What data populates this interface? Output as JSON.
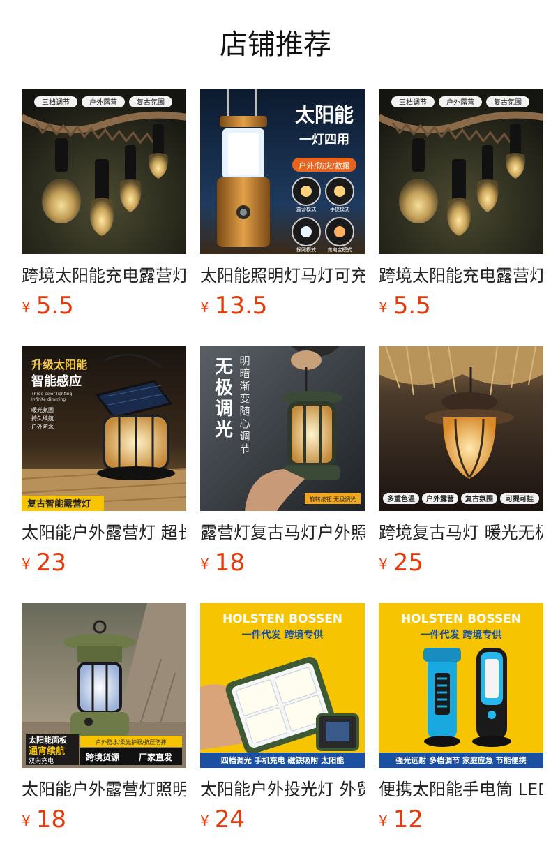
{
  "page": {
    "title": "店铺推荐"
  },
  "colors": {
    "price": "#e8380d",
    "brand_yellow": "#f6c400",
    "brand_blue": "#1b4fa0"
  },
  "products": [
    {
      "name": "跨境太阳能充电露营灯",
      "currency": "¥",
      "price": "5.5",
      "image": {
        "style": "bulbs",
        "tags": [
          "三档调节",
          "户外露营",
          "复古氛围"
        ]
      }
    },
    {
      "name": "太阳能照明灯马灯可充电",
      "currency": "¥",
      "price": "13.5",
      "image": {
        "style": "solar-lantern",
        "headline": "太阳能",
        "subline": "一灯四用",
        "pill": "户外/防灾/救援",
        "modes": [
          "露营模式",
          "手提模式",
          "探照模式",
          "充电宝模式"
        ]
      }
    },
    {
      "name": "跨境太阳能充电露营灯",
      "currency": "¥",
      "price": "5.5",
      "image": {
        "style": "bulbs",
        "tags": [
          "三档调节",
          "户外露营",
          "复古氛围"
        ]
      }
    },
    {
      "name": "太阳能户外露营灯 超长续航",
      "currency": "¥",
      "price": "23",
      "image": {
        "style": "smart-solar",
        "headline": "升级太阳能",
        "subline": "智能感应",
        "small_en": [
          "Three color lighting",
          "Infinite dimming"
        ],
        "features": [
          "暖光氛围",
          "持久续航",
          "户外防水"
        ],
        "footer": "复古智能露营灯"
      }
    },
    {
      "name": "露营灯复古马灯户外照明",
      "currency": "¥",
      "price": "18",
      "image": {
        "style": "dimming",
        "vertical_big": "无极调光",
        "vertical_small": "明暗渐变随心调节",
        "badge": "旋转按钮 无极调光"
      }
    },
    {
      "name": "跨境复古马灯 暖光无极调光",
      "currency": "¥",
      "price": "25",
      "image": {
        "style": "hanging",
        "tags": [
          "多重色温",
          "户外露营",
          "复古氛围",
          "可提可挂"
        ]
      }
    },
    {
      "name": "太阳能户外露营灯照明灯",
      "currency": "¥",
      "price": "18",
      "image": {
        "style": "green-lantern",
        "badge_lines": [
          "太阳能面板",
          "通宵续航",
          "双向充电"
        ],
        "features": "户外防水/柔光护眼/抗压防摔",
        "slogans": [
          "跨境货源",
          "厂家直发"
        ]
      }
    },
    {
      "name": "太阳能户外投光灯 外贸款",
      "currency": "¥",
      "price": "24",
      "image": {
        "style": "holsten-flood",
        "brand": "HOLSTEN BOSSEN",
        "tagline": "一件代发 跨境专供",
        "bottom": "四档调光 手机充电 磁铁吸附 太阳能"
      }
    },
    {
      "name": "便携太阳能手电筒 LED强光",
      "currency": "¥",
      "price": "12",
      "image": {
        "style": "holsten-torch",
        "brand": "HOLSTEN BOSSEN",
        "tagline": "一件代发 跨境专供",
        "bottom": "强光远射 多档调节 家庭应急 节能便携"
      }
    }
  ]
}
